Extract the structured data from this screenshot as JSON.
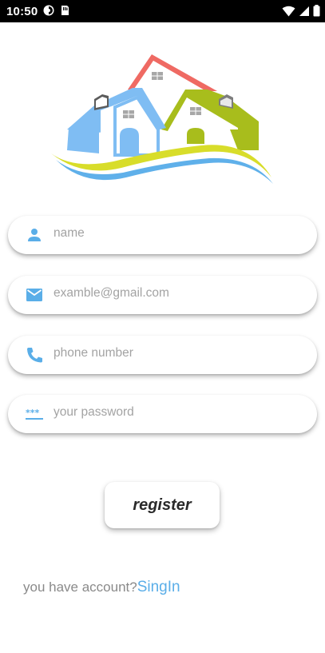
{
  "status_bar": {
    "time": "10:50",
    "icons": [
      "cloud-icon",
      "sim-card-icon",
      "wifi-icon",
      "signal-icon",
      "battery-icon"
    ]
  },
  "logo": {
    "icon": "houses-logo",
    "colors": {
      "roof_red": "#ef6a63",
      "house_blue": "#7fbdf3",
      "house_green": "#a8bd1c",
      "wave_yellow": "#d8dd2a",
      "wave_blue": "#5fb0ea"
    }
  },
  "form": {
    "name": {
      "placeholder": "name",
      "icon": "person-icon"
    },
    "email": {
      "placeholder": "examble@gmail.com",
      "icon": "mail-icon"
    },
    "phone": {
      "placeholder": "phone number",
      "icon": "phone-icon"
    },
    "password": {
      "placeholder": "your password",
      "icon": "password-icon"
    }
  },
  "register_button": {
    "label": "register"
  },
  "account_prompt": {
    "question": "you have account?",
    "link": "SingIn"
  },
  "colors": {
    "accent": "#5aaee8",
    "placeholder": "#a3a3a3"
  }
}
